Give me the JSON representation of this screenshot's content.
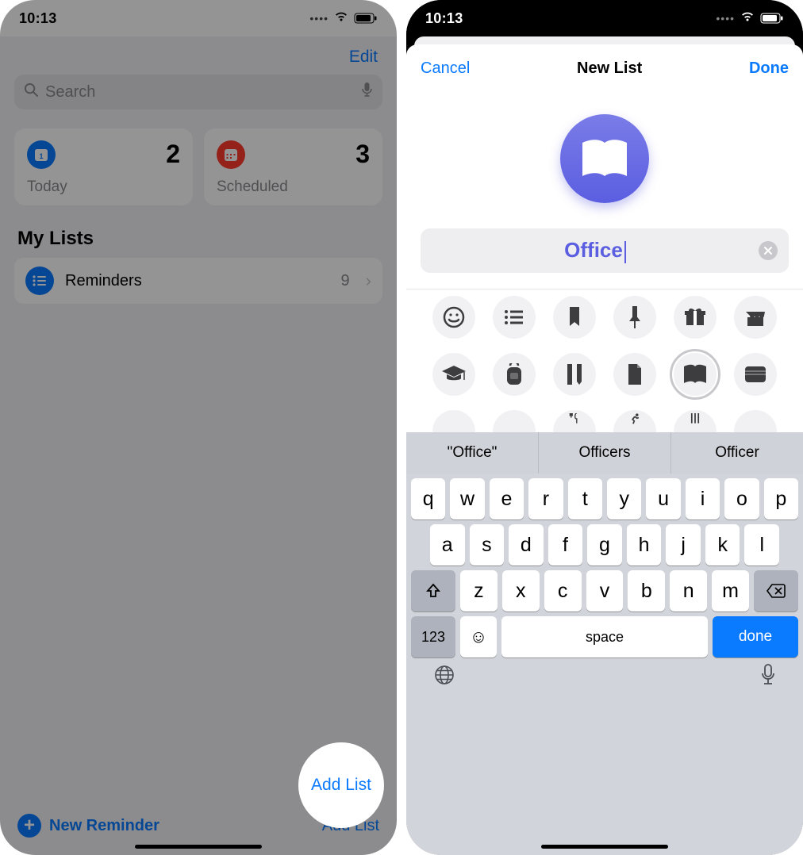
{
  "status": {
    "time": "10:13"
  },
  "left": {
    "edit": "Edit",
    "search_placeholder": "Search",
    "cards": {
      "today": {
        "label": "Today",
        "count": "2"
      },
      "scheduled": {
        "label": "Scheduled",
        "count": "3"
      }
    },
    "section_title": "My Lists",
    "list": {
      "name": "Reminders",
      "count": "9"
    },
    "new_reminder": "New Reminder",
    "add_list": "Add List"
  },
  "right": {
    "cancel": "Cancel",
    "title": "New List",
    "done": "Done",
    "name_value": "Office",
    "suggestions": [
      "\"Office\"",
      "Officers",
      "Officer"
    ],
    "keys_row1": [
      "q",
      "w",
      "e",
      "r",
      "t",
      "y",
      "u",
      "i",
      "o",
      "p"
    ],
    "keys_row2": [
      "a",
      "s",
      "d",
      "f",
      "g",
      "h",
      "j",
      "k",
      "l"
    ],
    "keys_row3": [
      "z",
      "x",
      "c",
      "v",
      "b",
      "n",
      "m"
    ],
    "key_123": "123",
    "key_space": "space",
    "key_done": "done"
  }
}
